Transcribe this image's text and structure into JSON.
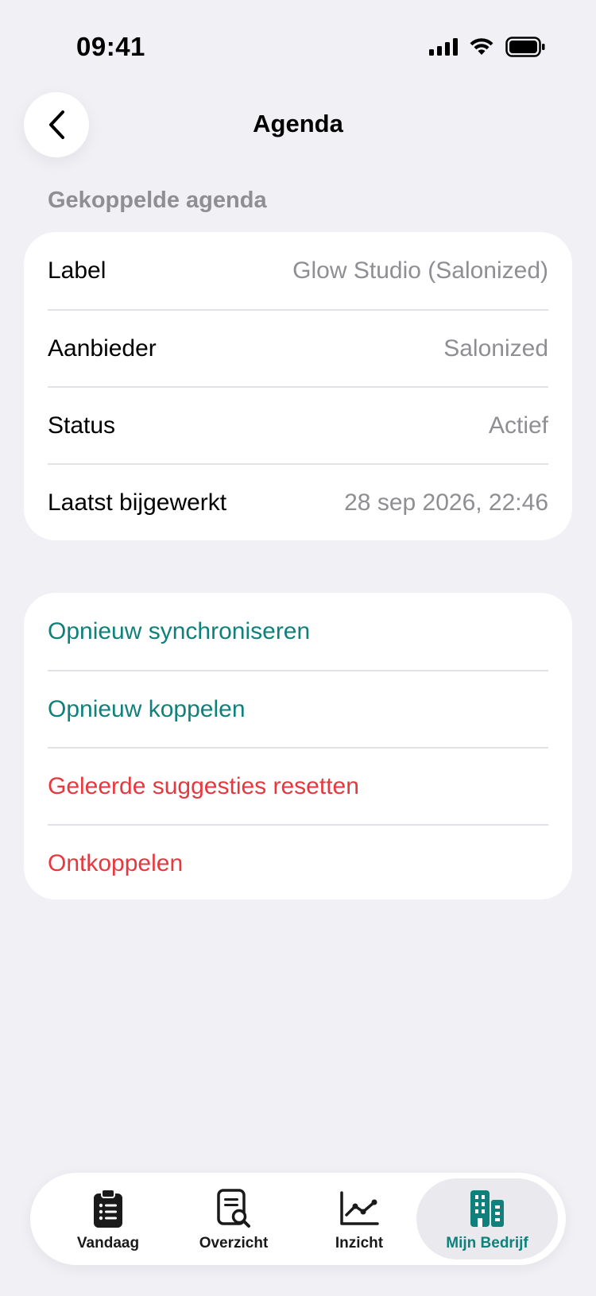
{
  "status_bar": {
    "time": "09:41"
  },
  "nav": {
    "title": "Agenda"
  },
  "section": {
    "header": "Gekoppelde agenda"
  },
  "info_rows": [
    {
      "key": "Label",
      "value": "Glow Studio (Salonized)"
    },
    {
      "key": "Aanbieder",
      "value": "Salonized"
    },
    {
      "key": "Status",
      "value": "Actief"
    },
    {
      "key": "Laatst bijgewerkt",
      "value": "28 sep 2026, 22:46"
    }
  ],
  "actions": [
    {
      "label": "Opnieuw synchroniseren",
      "color": "#10807A"
    },
    {
      "label": "Opnieuw koppelen",
      "color": "#10807A"
    },
    {
      "label": "Geleerde suggesties resetten",
      "color": "#E5393F"
    },
    {
      "label": "Ontkoppelen",
      "color": "#E5393F"
    }
  ],
  "tabbar": {
    "tabs": [
      {
        "label": "Vandaag",
        "icon": "clipboard-list-icon"
      },
      {
        "label": "Overzicht",
        "icon": "document-search-icon"
      },
      {
        "label": "Inzicht",
        "icon": "line-chart-icon"
      },
      {
        "label": "Mijn Bedrijf",
        "icon": "building-icon",
        "active": true
      }
    ]
  },
  "colors": {
    "accent": "#10807A",
    "destructive": "#E5393F",
    "background": "#F0F0F5"
  }
}
